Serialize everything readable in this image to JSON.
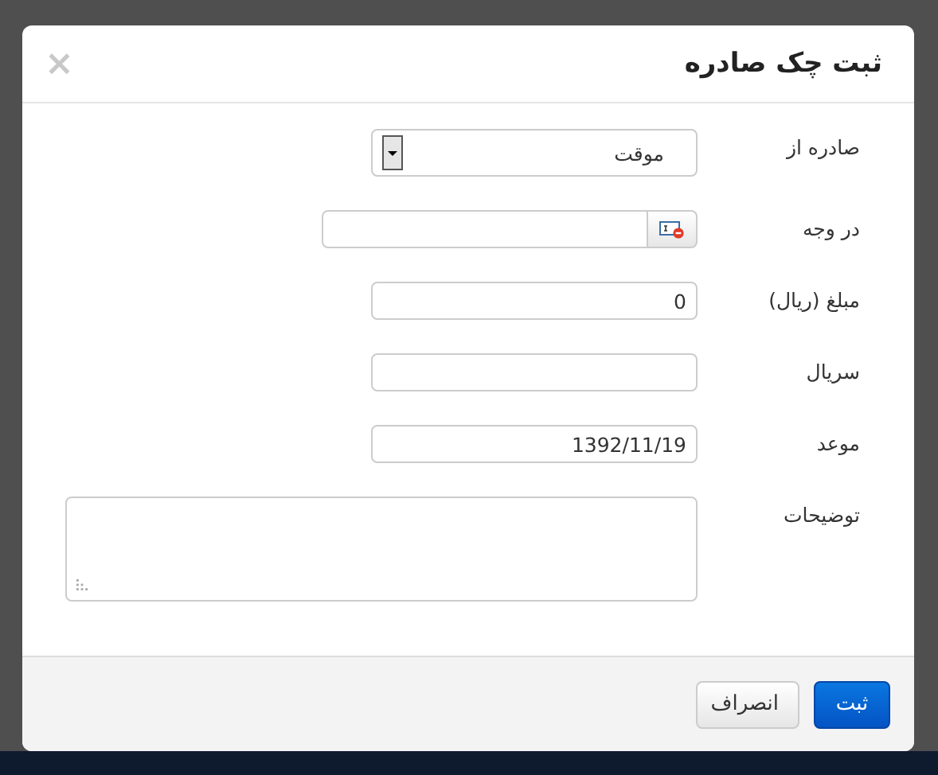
{
  "dialog": {
    "title": "ثبت چک صادره",
    "close": "×"
  },
  "fields": [
    {
      "kind": "select",
      "label": "صادره از",
      "value": "موقت"
    },
    {
      "kind": "picker",
      "label": "در وجه"
    },
    {
      "kind": "text",
      "label": "مبلغ (ریال)",
      "value": "0"
    },
    {
      "kind": "text",
      "label": "سریال"
    },
    {
      "kind": "text",
      "label": "موعد",
      "value": "1392/11/19"
    },
    {
      "kind": "textarea",
      "label": "توضیحات"
    }
  ],
  "buttons": [
    {
      "label": "ثبت",
      "kind": "primary"
    },
    {
      "label": "انصراف",
      "kind": "default"
    }
  ]
}
